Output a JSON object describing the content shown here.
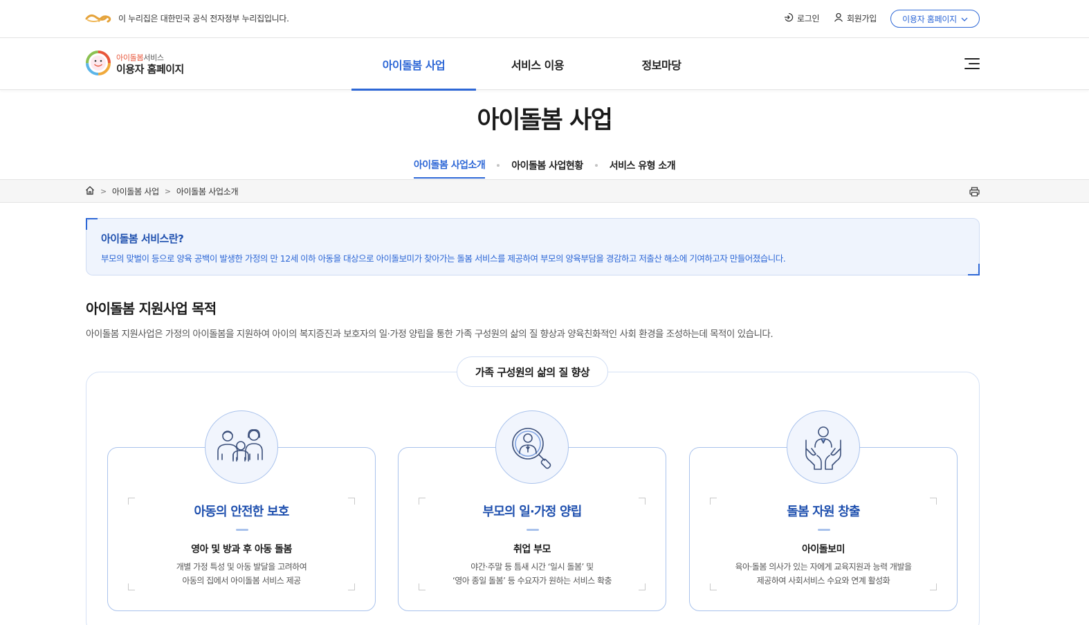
{
  "gov_banner": {
    "text": "이 누리집은 대한민국 공식 전자정부 누리집입니다.",
    "logo_icon": "egov-logo-icon",
    "login_label": "로그인",
    "join_label": "회원가입",
    "user_home_label": "이용자 홈페이지"
  },
  "brand": {
    "sub_accent": "아이돌봄",
    "sub_rest": "서비스",
    "main": "이용자 홈페이지"
  },
  "gnb": {
    "items": [
      {
        "label": "아이돌봄 사업",
        "active": true
      },
      {
        "label": "서비스 이용",
        "active": false
      },
      {
        "label": "정보마당",
        "active": false
      }
    ]
  },
  "page": {
    "title": "아이돌봄 사업",
    "tabs": [
      {
        "label": "아이돌봄 사업소개",
        "active": true
      },
      {
        "label": "아이돌봄 사업현황",
        "active": false
      },
      {
        "label": "서비스 유형 소개",
        "active": false
      }
    ]
  },
  "breadcrumb": {
    "items": [
      "아이돌봄 사업",
      "아이돌봄 사업소개"
    ]
  },
  "intro": {
    "title": "아이돌봄 서비스란?",
    "description": "부모의 맞벌이 등으로 양육 공백이 발생한 가정의 만 12세 이하 아동을 대상으로 아이돌보미가 찾아가는 돌봄 서비스를 제공하여 부모의 양육부담을 경감하고 저출산 해소에 기여하고자 만들어졌습니다."
  },
  "purpose": {
    "title": "아이돌봄 지원사업 목적",
    "description": "아이돌봄 지원사업은 가정의 아이돌봄을 지원하여 아이의 복지증진과 보호자의 일·가정 양립을 통한 가족 구성원의 삶의 질 향상과 양육친화적인 사회 환경을 조성하는데 목적이 있습니다.",
    "goal": "가족 구성원의 삶의 질 향상",
    "cards": [
      {
        "icon": "family-icon",
        "title": "아동의 안전한 보호",
        "subtitle": "영아 및 방과 후 아동 돌봄",
        "desc_line1": "개별 가정 특성 및 아동 발달을 고려하여",
        "desc_line2": "아동의 집에서 아이돌봄 서비스 제공"
      },
      {
        "icon": "person-search-icon",
        "title": "부모의 일·가정 양립",
        "subtitle": "취업 부모",
        "desc_line1": "야간·주말 등 틈새 시간 ‘일시 돌봄’ 및",
        "desc_line2": "‘영아 종일 돌봄’ 등 수요자가 원하는 서비스 확충"
      },
      {
        "icon": "care-hands-icon",
        "title": "돌봄 자원 창출",
        "subtitle": "아이돌보미",
        "desc_line1": "육아·돌봄 의사가 있는 자에게 교육지원과 능력 개발을",
        "desc_line2": "제공하여 사회서비스 수요와 연계 활성화"
      }
    ]
  },
  "colors": {
    "primary": "#2d67d6",
    "primary_dark": "#1e4fae",
    "intro_bg": "#eff4fd",
    "card_border": "#a9c2ec",
    "brand_accent": "#e8563a"
  }
}
